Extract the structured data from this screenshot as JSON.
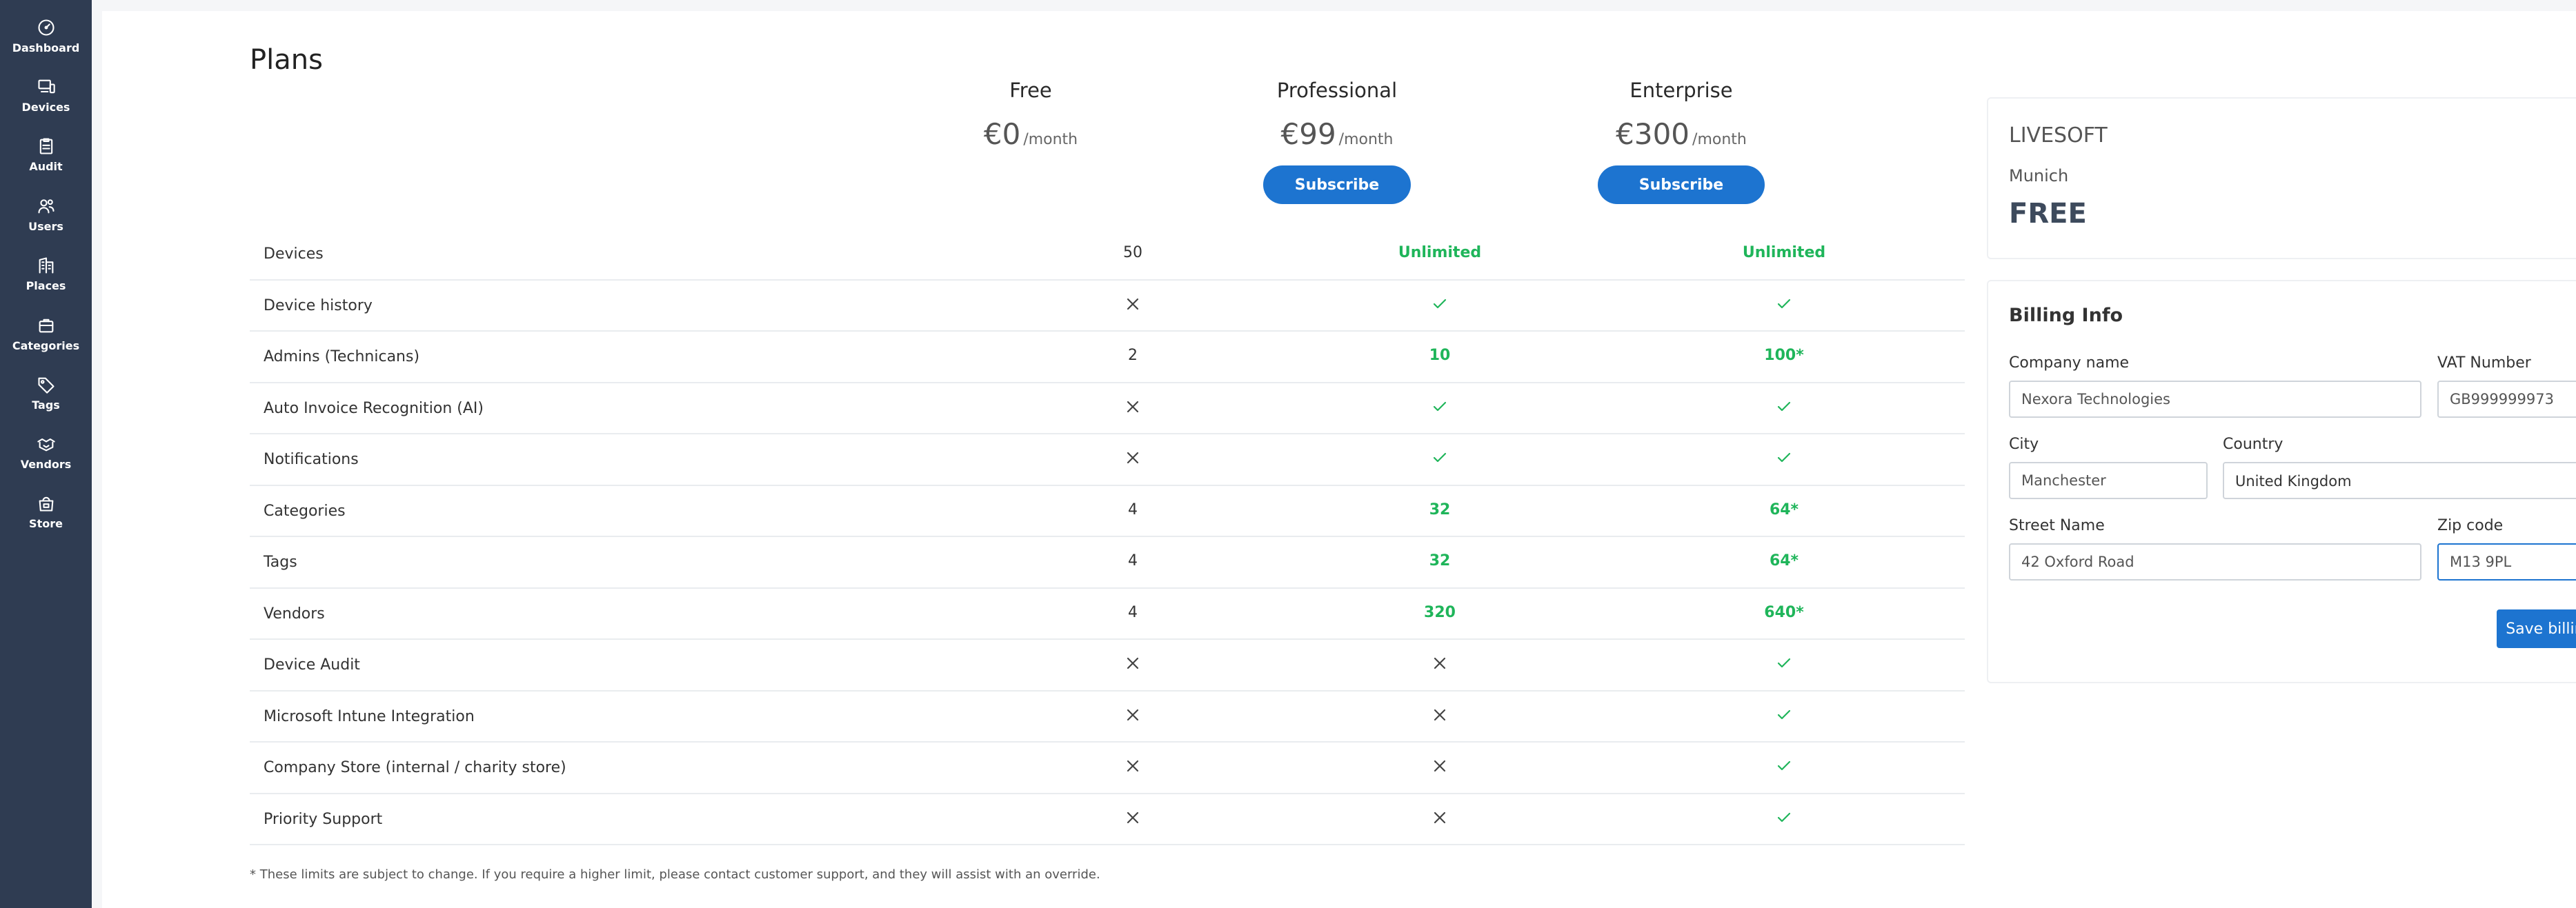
{
  "sidebar": {
    "items": [
      {
        "label": "Dashboard",
        "icon": "dashboard-icon"
      },
      {
        "label": "Devices",
        "icon": "devices-icon"
      },
      {
        "label": "Audit",
        "icon": "audit-icon"
      },
      {
        "label": "Users",
        "icon": "users-icon"
      },
      {
        "label": "Places",
        "icon": "places-icon"
      },
      {
        "label": "Categories",
        "icon": "categories-icon"
      },
      {
        "label": "Tags",
        "icon": "tags-icon"
      },
      {
        "label": "Vendors",
        "icon": "vendors-icon"
      },
      {
        "label": "Store",
        "icon": "store-icon"
      }
    ]
  },
  "page": {
    "title": "Plans"
  },
  "plans": [
    {
      "name": "Free",
      "price": "€0",
      "period": "/month"
    },
    {
      "name": "Professional",
      "price": "€99",
      "period": "/month",
      "button": "Subscribe"
    },
    {
      "name": "Enterprise",
      "price": "€300",
      "period": "/month",
      "button": "Subscribe"
    }
  ],
  "features": [
    {
      "name": "Devices",
      "free": "50",
      "pro": "Unlimited",
      "ent": "Unlimited"
    },
    {
      "name": "Device history",
      "free": "x",
      "pro": "check",
      "ent": "check"
    },
    {
      "name": "Admins (Technicans)",
      "free": "2",
      "pro": "10",
      "ent": "100*"
    },
    {
      "name": "Auto Invoice Recognition (AI)",
      "free": "x",
      "pro": "check",
      "ent": "check"
    },
    {
      "name": "Notifications",
      "free": "x",
      "pro": "check",
      "ent": "check"
    },
    {
      "name": "Categories",
      "free": "4",
      "pro": "32",
      "ent": "64*"
    },
    {
      "name": "Tags",
      "free": "4",
      "pro": "32",
      "ent": "64*"
    },
    {
      "name": "Vendors",
      "free": "4",
      "pro": "320",
      "ent": "640*"
    },
    {
      "name": "Device Audit",
      "free": "x",
      "pro": "x",
      "ent": "check"
    },
    {
      "name": "Microsoft Intune Integration",
      "free": "x",
      "pro": "x",
      "ent": "check"
    },
    {
      "name": "Company Store (internal / charity store)",
      "free": "x",
      "pro": "x",
      "ent": "check"
    },
    {
      "name": "Priority Support",
      "free": "x",
      "pro": "x",
      "ent": "check"
    }
  ],
  "footnote": "* These limits are subject to change. If you require a higher limit, please contact customer support, and they will assist with an override.",
  "company": {
    "name": "LIVESOFT",
    "city": "Munich",
    "plan": "FREE"
  },
  "billing": {
    "title": "Billing Info",
    "company_label": "Company name",
    "company_value": "Nexora Technologies",
    "vat_label": "VAT Number",
    "vat_value": "GB999999973",
    "city_label": "City",
    "city_value": "Manchester",
    "country_label": "Country",
    "country_value": "United Kingdom",
    "street_label": "Street Name",
    "street_value": "42 Oxford Road",
    "zip_label": "Zip code",
    "zip_value": "M13 9PL",
    "save_label": "Save billing info"
  },
  "colors": {
    "sidebar": "#2f3c52",
    "accent": "#1d74d0",
    "positive": "#1fb55a",
    "danger": "#e24848"
  }
}
